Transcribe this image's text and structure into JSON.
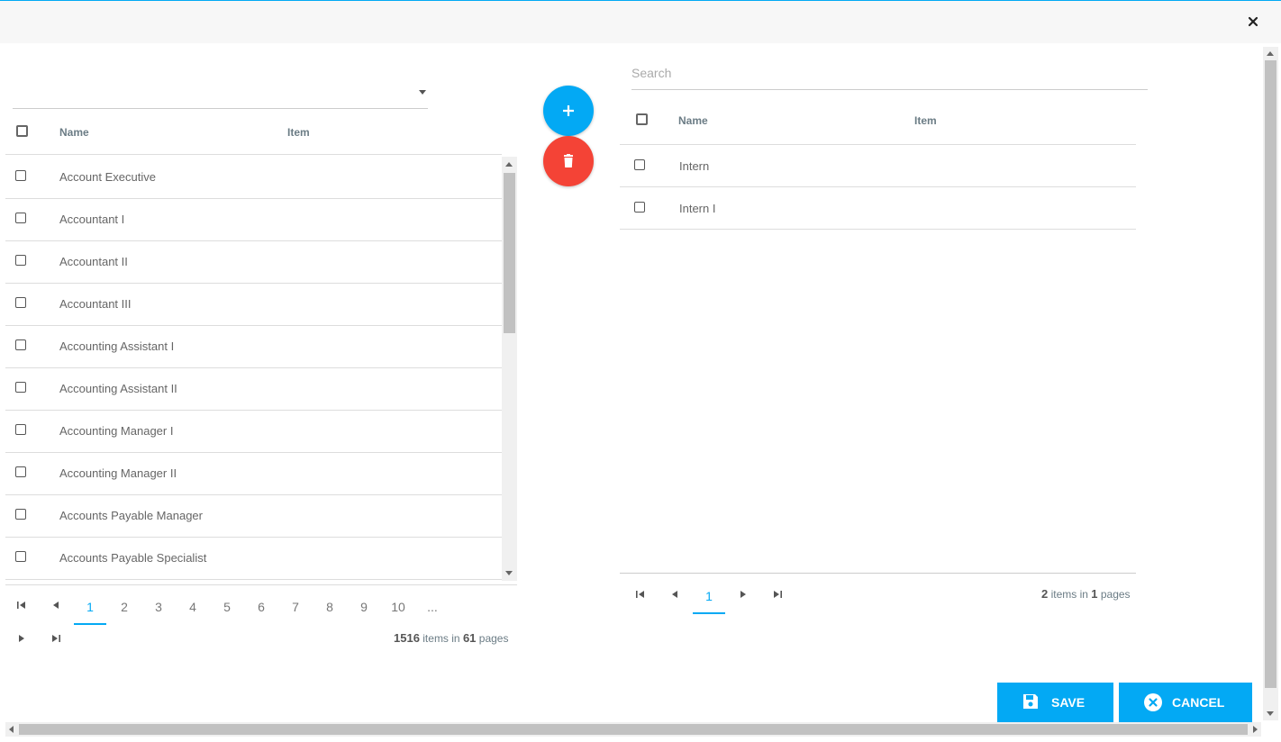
{
  "dialog": {
    "close_icon": "close-icon"
  },
  "left": {
    "header": {
      "name": "Name",
      "item": "Item"
    },
    "rows": [
      "Account Executive",
      "Accountant I",
      "Accountant II",
      "Accountant III",
      "Accounting Assistant I",
      "Accounting Assistant II",
      "Accounting Manager I",
      "Accounting Manager II",
      "Accounts Payable Manager",
      "Accounts Payable Specialist"
    ],
    "pager": {
      "pages": [
        "1",
        "2",
        "3",
        "4",
        "5",
        "6",
        "7",
        "8",
        "9",
        "10",
        "..."
      ],
      "active_page": "1",
      "total_items": "1516",
      "items_in": "items in",
      "total_pages": "61",
      "pages_label": "pages"
    }
  },
  "middle": {
    "add_icon": "plus-icon",
    "delete_icon": "trash-icon"
  },
  "right": {
    "search": {
      "placeholder": "Search"
    },
    "header": {
      "name": "Name",
      "item": "Item"
    },
    "rows": [
      "Intern",
      "Intern I"
    ],
    "pager": {
      "active_page": "1",
      "total_items": "2",
      "items_in": "items in",
      "total_pages": "1",
      "pages_label": "pages"
    }
  },
  "actions": {
    "save_label": "SAVE",
    "cancel_label": "CANCEL"
  },
  "colors": {
    "accent": "#03a9f4",
    "danger": "#f44336"
  }
}
